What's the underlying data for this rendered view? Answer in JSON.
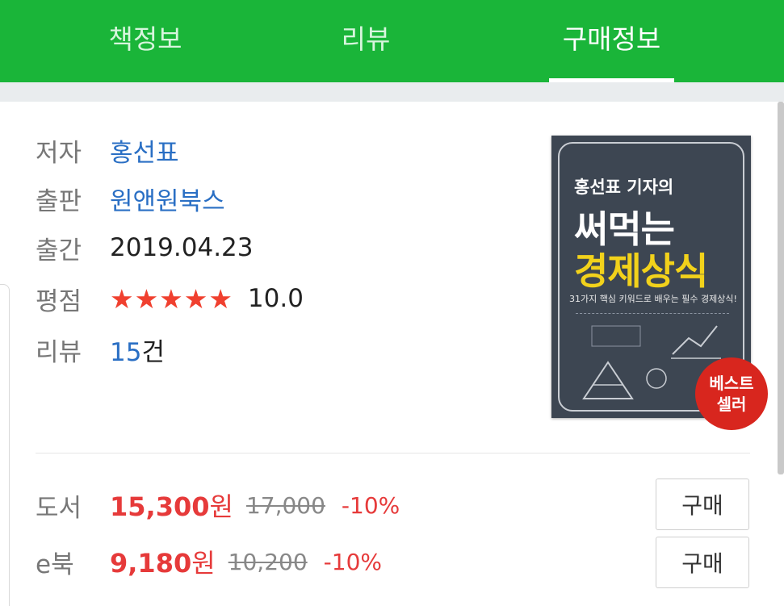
{
  "tabs": [
    {
      "label": "책정보"
    },
    {
      "label": "리뷰"
    },
    {
      "label": "구매정보",
      "active": true
    }
  ],
  "info": {
    "author_label": "저자",
    "author": "홍선표",
    "publisher_label": "출판",
    "publisher": "원앤원북스",
    "date_label": "출간",
    "date": "2019.04.23",
    "rating_label": "평점",
    "stars": "★★★★★",
    "rating": "10.0",
    "review_label": "리뷰",
    "review_count": "15",
    "review_unit": "건"
  },
  "cover": {
    "subtitle": "홍선표 기자의",
    "title_line1": "써먹는",
    "title_line2": "경제상식",
    "tagline": "31가지 핵심 키워드로 배우는 필수 경제상식!",
    "badge_line1": "베스트",
    "badge_line2": "셀러"
  },
  "prices": [
    {
      "label": "도서",
      "price": "15,300",
      "won": "원",
      "original": "17,000",
      "discount": "-10%",
      "buy": "구매"
    },
    {
      "label": "e북",
      "price": "9,180",
      "won": "원",
      "original": "10,200",
      "discount": "-10%",
      "buy": "구매"
    }
  ],
  "colors": {
    "accent": "#1ab539",
    "link": "#2a6fc4",
    "price": "#e63a3a",
    "star": "#f0402f"
  }
}
